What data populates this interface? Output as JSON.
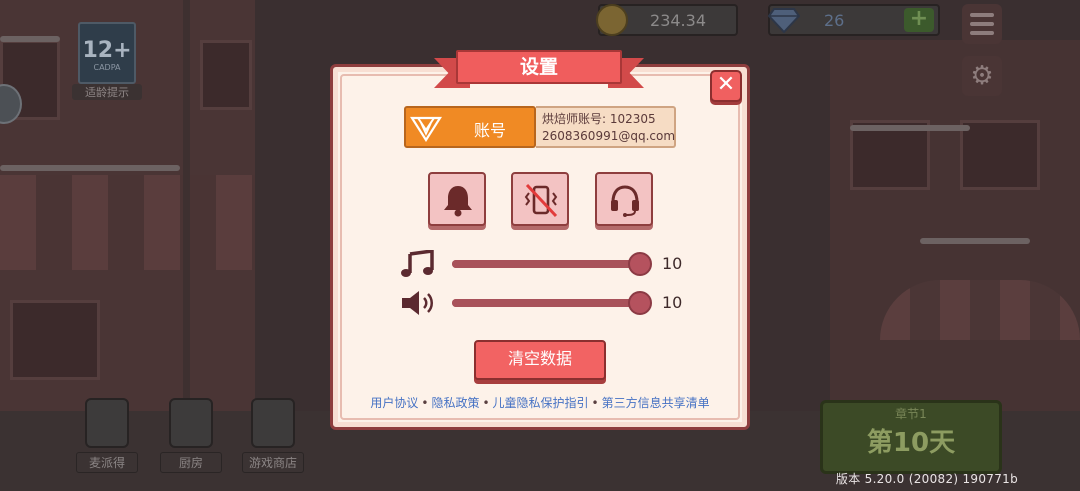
{
  "hud": {
    "coins": "234.34",
    "gems": "26",
    "plus_label": "+",
    "gear_glyph": "⚙"
  },
  "age_rating": {
    "number": "12+",
    "org": "CADPA",
    "label": "适龄提示"
  },
  "nav": [
    {
      "label": "麦派得",
      "icon": "tablet-icon"
    },
    {
      "label": "厨房",
      "icon": "lock-icon"
    },
    {
      "label": "游戏商店",
      "icon": "shop-icon"
    }
  ],
  "chapter": {
    "title": "章节1",
    "day": "第10天"
  },
  "version": "版本  5.20.0 (20082) 190771b",
  "settings": {
    "title": "设置",
    "close_label": "✕",
    "account_button": "账号",
    "account_id_line": "烘焙师账号: 102305",
    "account_email": "2608360991@qq.com",
    "toggles": [
      {
        "name": "sound-toggle",
        "icon": "bell-icon",
        "enabled": true
      },
      {
        "name": "vibration-toggle",
        "icon": "vibration-off-icon",
        "enabled": false
      },
      {
        "name": "support-button",
        "icon": "headset-icon",
        "enabled": true
      }
    ],
    "music_volume": 10,
    "sfx_volume": 10,
    "volume_max": 10,
    "clear_data_label": "清空数据",
    "links": [
      "用户协议",
      "隐私政策",
      "儿童隐私保护指引",
      "第三方信息共享清单"
    ],
    "link_separator": "•"
  },
  "colors": {
    "accent_red": "#f05d5d",
    "account_orange": "#f08a24",
    "panel_bg": "#fdf2e9",
    "link_blue": "#4672c4",
    "slider": "#a8525a"
  }
}
